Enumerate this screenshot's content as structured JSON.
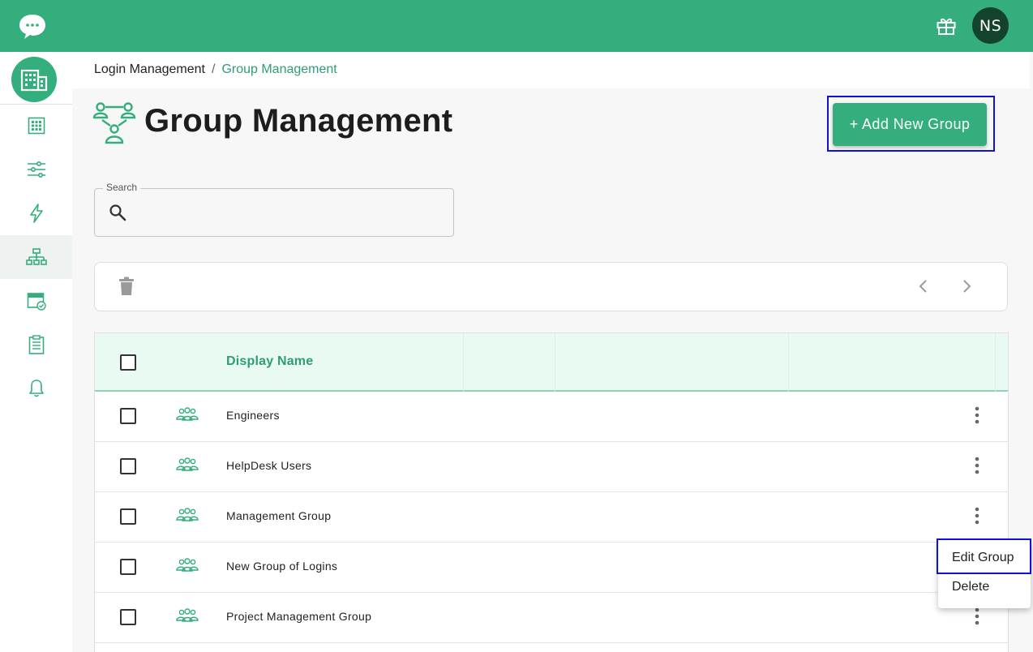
{
  "header": {
    "avatar_initials": "NS",
    "accent_color": "#33ae7c",
    "icons": [
      "chat-logo-icon",
      "gift-icon"
    ]
  },
  "sidebar": {
    "items": [
      {
        "icon": "building-grid-icon"
      },
      {
        "icon": "sliders-icon"
      },
      {
        "icon": "lightning-icon"
      },
      {
        "icon": "org-chart-icon",
        "active": true
      },
      {
        "icon": "calendar-check-icon"
      },
      {
        "icon": "clipboard-icon"
      },
      {
        "icon": "bell-icon"
      }
    ]
  },
  "breadcrumb": {
    "parent": "Login Management",
    "separator": "/",
    "current": "Group Management"
  },
  "page": {
    "title": "Group Management",
    "add_button_label": "+ Add New Group"
  },
  "search": {
    "label": "Search",
    "placeholder": "",
    "value": ""
  },
  "table": {
    "columns": [
      "Display Name"
    ],
    "rows": [
      {
        "name": "Engineers"
      },
      {
        "name": "HelpDesk Users"
      },
      {
        "name": "Management Group"
      },
      {
        "name": "New Group of Logins"
      },
      {
        "name": "Project Management Group"
      }
    ]
  },
  "context_menu": {
    "items": [
      "Edit Group",
      "Delete"
    ]
  }
}
